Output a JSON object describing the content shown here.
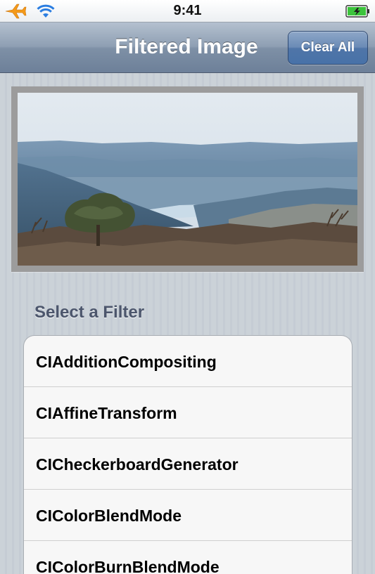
{
  "status_bar": {
    "time": "9:41"
  },
  "nav_bar": {
    "title": "Filtered Image",
    "clear_all_label": "Clear All"
  },
  "section": {
    "header": "Select a Filter"
  },
  "filters": [
    "CIAdditionCompositing",
    "CIAffineTransform",
    "CICheckerboardGenerator",
    "CIColorBlendMode",
    "CIColorBurnBlendMode"
  ],
  "colors": {
    "nav_bar": "#8e9fb3",
    "button": "#4f75a8",
    "airplane_icon": "#f49a1a",
    "wifi_icon": "#2a7de1",
    "battery_fill": "#3cc43c",
    "section_header": "#4c566c"
  },
  "icons": [
    "airplane-mode-icon",
    "wifi-icon",
    "battery-icon"
  ]
}
